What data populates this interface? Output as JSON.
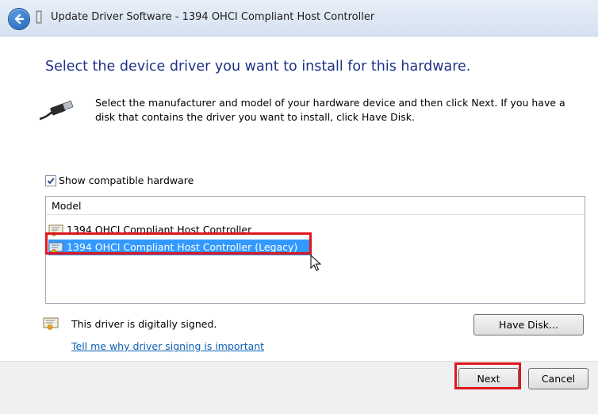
{
  "window": {
    "title": "Update Driver Software - 1394 OHCI Compliant Host Controller"
  },
  "heading": "Select the device driver you want to install for this hardware.",
  "instructions": "Select the manufacturer and model of your hardware device and then click Next. If you have a disk that contains the driver you want to install, click Have Disk.",
  "compatible": {
    "label": "Show compatible hardware",
    "checked": true
  },
  "model_list": {
    "header": "Model",
    "items": [
      {
        "label": "1394 OHCI Compliant Host Controller",
        "selected": false
      },
      {
        "label": "1394 OHCI Compliant Host Controller (Legacy)",
        "selected": true
      }
    ]
  },
  "signing": {
    "status": "This driver is digitally signed.",
    "link": "Tell me why driver signing is important"
  },
  "buttons": {
    "have_disk": "Have Disk...",
    "next": "Next",
    "cancel": "Cancel"
  },
  "colors": {
    "heading": "#1e3287",
    "selection": "#3399ff",
    "highlight": "#e0161f",
    "link": "#0b5fb3"
  },
  "icons": {
    "back": "back-arrow-icon",
    "device": "usb-plug-icon",
    "driver": "driver-certificate-icon",
    "cursor": "mouse-pointer-icon"
  }
}
